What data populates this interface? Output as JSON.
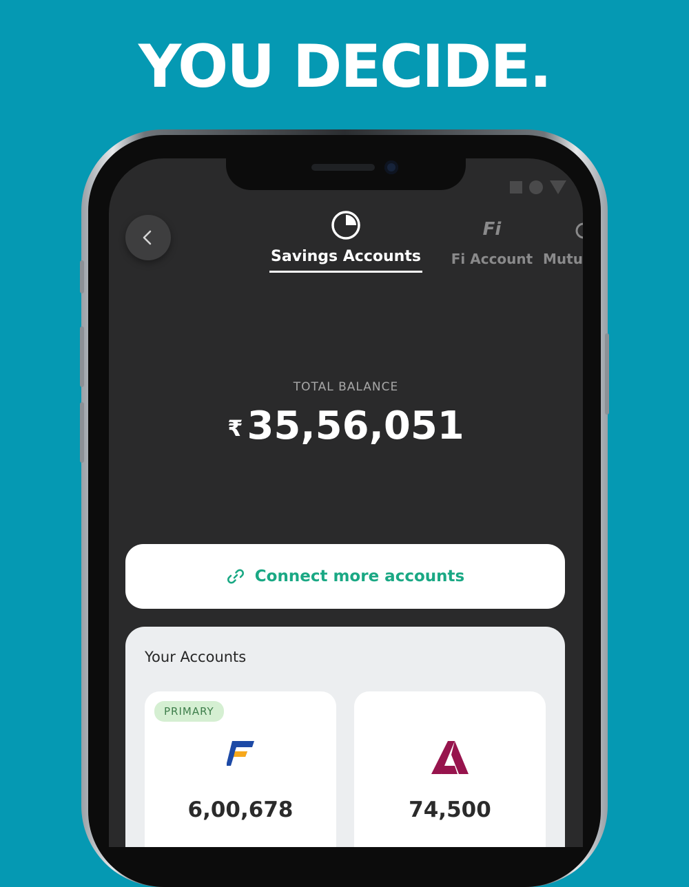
{
  "headline": "YOU DECIDE.",
  "header": {
    "tabs": [
      {
        "label": "Savings Accounts",
        "active": true,
        "icon": "pie-chart-icon"
      },
      {
        "label": "Fi Account",
        "active": false,
        "icon": "fi-logo-icon"
      },
      {
        "label": "Mutu",
        "active": false,
        "icon": "mutual-funds-icon"
      }
    ],
    "fi_glyph": "Fi"
  },
  "balance": {
    "label": "TOTAL BALANCE",
    "currency_symbol": "₹",
    "amount": "35,56,051"
  },
  "connect": {
    "label": "Connect more accounts",
    "icon": "link-icon",
    "color": "#1aa884"
  },
  "accounts": {
    "title": "Your Accounts",
    "items": [
      {
        "badge": "PRIMARY",
        "bank_icon": "federal-bank-logo-icon",
        "amount": "6,00,678"
      },
      {
        "badge": "",
        "bank_icon": "axis-bank-logo-icon",
        "amount": "74,500"
      }
    ]
  },
  "colors": {
    "background": "#0599b3",
    "screen": "#2a2a2b",
    "accent_green": "#1aa884",
    "badge_bg": "#d5efd2"
  }
}
